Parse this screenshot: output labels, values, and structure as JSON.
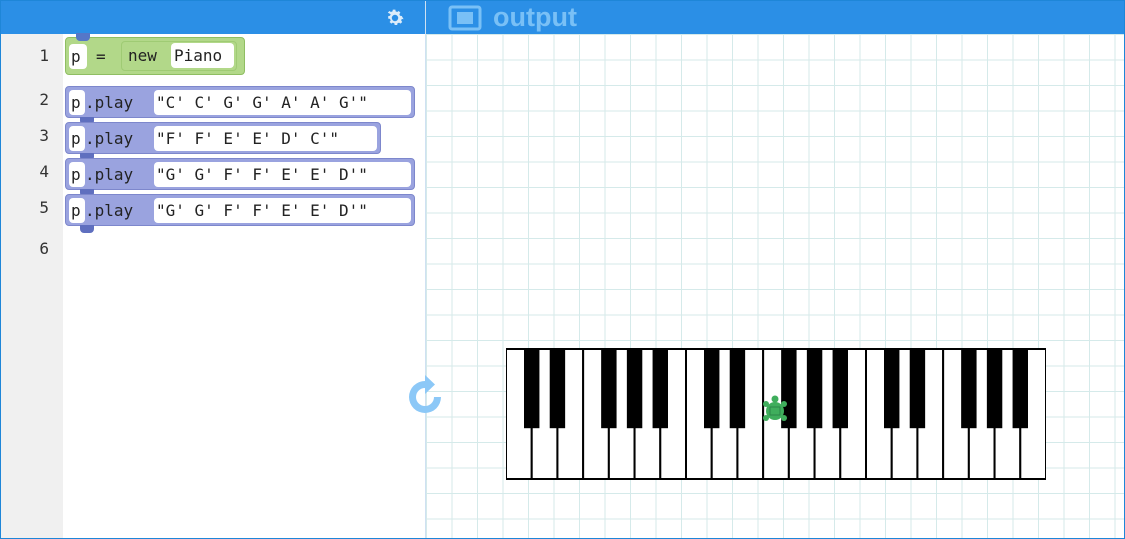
{
  "output_pane": {
    "title": "output"
  },
  "editor": {
    "line_numbers": [
      "1",
      "2",
      "3",
      "4",
      "5",
      "6"
    ],
    "line1": {
      "var": "p",
      "op": "=",
      "keyword": "new",
      "class": "Piano"
    },
    "play_lines": [
      {
        "var": "p",
        "method": ".play",
        "notes": "\"C' C' G' G' A' A' G'\""
      },
      {
        "var": "p",
        "method": ".play",
        "notes": "\"F' F' E' E' D' C'\""
      },
      {
        "var": "p",
        "method": ".play",
        "notes": "\"G' G' F' F' E' E' D'\""
      },
      {
        "var": "p",
        "method": ".play",
        "notes": "\"G' G' F' F' E' E' D'\""
      }
    ]
  },
  "piano": {
    "white_keys": 21,
    "black_key_pattern": [
      1,
      1,
      0,
      1,
      1,
      1,
      0
    ],
    "turtle_icon": "turtle-icon"
  },
  "colors": {
    "header_blue": "#2b8fe6",
    "block_green": "#b2d889",
    "block_purple": "#9aa3df",
    "turtle_green": "#3fae5c",
    "rerun_blue": "#8cc8f7"
  },
  "icons": {
    "settings": "gear-icon",
    "output": "screen-icon",
    "run": "rerun-icon"
  }
}
